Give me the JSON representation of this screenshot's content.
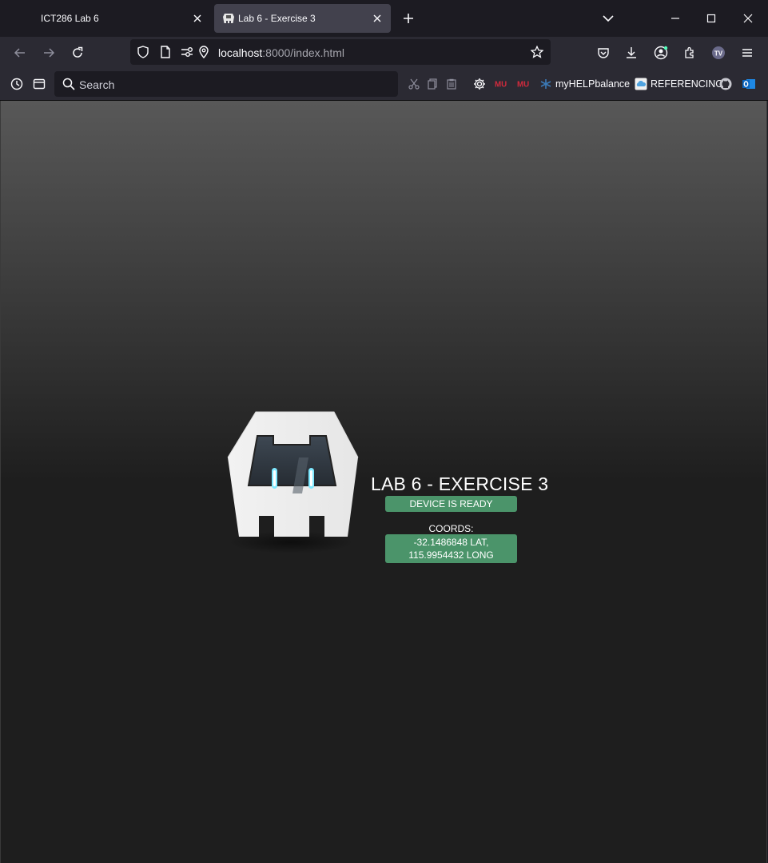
{
  "tabs": [
    {
      "title": "ICT286 Lab 6",
      "active": false
    },
    {
      "title": "Lab 6 - Exercise 3",
      "active": true
    }
  ],
  "url": {
    "host": "localhost",
    "path": ":8000/index.html"
  },
  "search": {
    "placeholder": "Search"
  },
  "bookmarks": [
    {
      "label": "myHELPbalance",
      "icon": "snowflake-icon"
    },
    {
      "label": "REFERENCING",
      "icon": "cloud-icon"
    }
  ],
  "colors": {
    "status_green": "#4b946a",
    "chrome_dark": "#1c1b22",
    "toolbar": "#2b2a33",
    "mu_red": "#d22a3d"
  },
  "app": {
    "title": "LAB 6 - EXERCISE 3",
    "status": "DEVICE IS READY",
    "coords_label": "COORDS:",
    "coords_value": "-32.1486848 LAT, 115.9954432 LONG"
  }
}
